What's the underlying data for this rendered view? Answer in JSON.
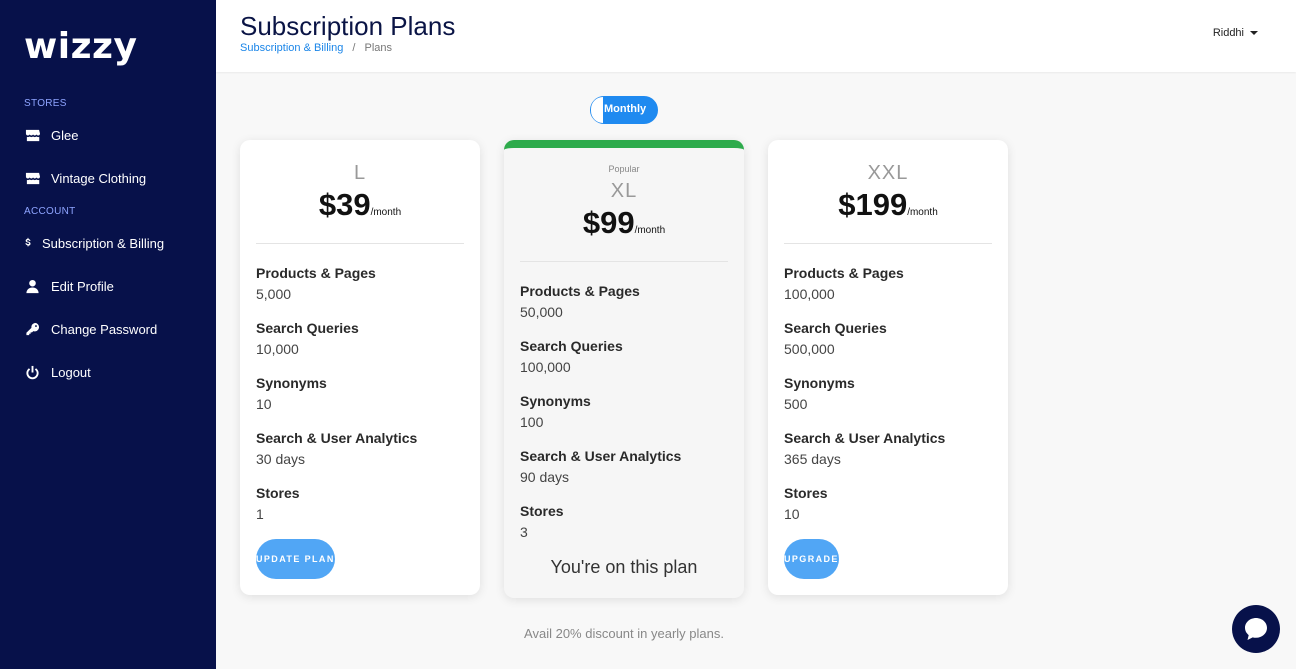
{
  "brand": {
    "logo_text": "wizzy"
  },
  "sidebar": {
    "stores_label": "STORES",
    "stores": [
      {
        "label": "Glee",
        "icon": "store-icon"
      },
      {
        "label": "Vintage Clothing",
        "icon": "store-icon"
      }
    ],
    "account_label": "ACCOUNT",
    "account": [
      {
        "label": "Subscription & Billing",
        "icon": "dollar-icon"
      },
      {
        "label": "Edit Profile",
        "icon": "user-icon"
      },
      {
        "label": "Change Password",
        "icon": "key-icon"
      },
      {
        "label": "Logout",
        "icon": "power-icon"
      }
    ]
  },
  "header": {
    "title": "Subscription Plans",
    "breadcrumb": {
      "parent": "Subscription & Billing",
      "current": "Plans"
    },
    "user_name": "Riddhi"
  },
  "billing_toggle": {
    "label": "Monthly"
  },
  "plans": [
    {
      "popular_label": "",
      "name": "L",
      "price": "$39",
      "period": "/month",
      "features": [
        {
          "name": "Products & Pages",
          "value": "5,000"
        },
        {
          "name": "Search Queries",
          "value": "10,000"
        },
        {
          "name": "Synonyms",
          "value": "10"
        },
        {
          "name": "Search & User Analytics",
          "value": "30 days"
        },
        {
          "name": "Stores",
          "value": "1"
        }
      ],
      "action_label": "UPDATE PLAN"
    },
    {
      "popular_label": "Popular",
      "name": "XL",
      "price": "$99",
      "period": "/month",
      "features": [
        {
          "name": "Products & Pages",
          "value": "50,000"
        },
        {
          "name": "Search Queries",
          "value": "100,000"
        },
        {
          "name": "Synonyms",
          "value": "100"
        },
        {
          "name": "Search & User Analytics",
          "value": "90 days"
        },
        {
          "name": "Stores",
          "value": "3"
        }
      ],
      "current_note": "You're on this plan"
    },
    {
      "popular_label": "",
      "name": "XXL",
      "price": "$199",
      "period": "/month",
      "features": [
        {
          "name": "Products & Pages",
          "value": "100,000"
        },
        {
          "name": "Search Queries",
          "value": "500,000"
        },
        {
          "name": "Synonyms",
          "value": "500"
        },
        {
          "name": "Search & User Analytics",
          "value": "365 days"
        },
        {
          "name": "Stores",
          "value": "10"
        }
      ],
      "action_label": "UPGRADE"
    }
  ],
  "discount_note": "Avail 20% discount in yearly plans.",
  "colors": {
    "sidebar": "#07114a",
    "accent": "#1f8af0",
    "button": "#51a6f5",
    "current_plan_bar": "#2eab4c"
  }
}
